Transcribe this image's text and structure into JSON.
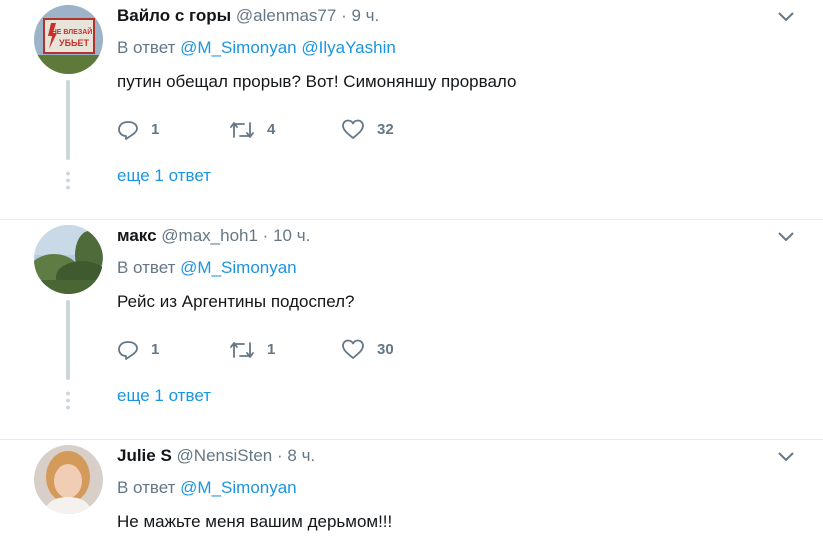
{
  "tweets": [
    {
      "name": "Вайло с горы",
      "handle": "@alenmas77",
      "dot": "·",
      "time": "9 ч.",
      "reply_prefix": "В ответ ",
      "mentions": [
        "@M_Simonyan",
        "@IlyaYashin"
      ],
      "text": "путин обещал прорыв? Вот! Симоняншу прорвало",
      "replies": "1",
      "retweets": "4",
      "likes": "32",
      "more_replies": "еще 1 ответ",
      "avatar_text": [
        "НЕ ВЛЕЗАЙ",
        "УБЬЕТ"
      ]
    },
    {
      "name": "макс",
      "handle": "@max_hoh1",
      "dot": "·",
      "time": "10 ч.",
      "reply_prefix": "В ответ ",
      "mentions": [
        "@M_Simonyan"
      ],
      "text": "Рейс из Аргентины подоспел?",
      "replies": "1",
      "retweets": "1",
      "likes": "30",
      "more_replies": "еще 1 ответ"
    },
    {
      "name": "Julie S",
      "handle": "@NensiSten",
      "dot": "·",
      "time": "8 ч.",
      "reply_prefix": "В ответ ",
      "mentions": [
        "@M_Simonyan"
      ],
      "text": "Не мажьте меня вашим дерьмом!!!"
    }
  ],
  "icons": {
    "caret": "chevron-down-icon",
    "reply": "reply-icon",
    "retweet": "retweet-icon",
    "like": "heart-icon"
  },
  "colors": {
    "link": "#1b95e0",
    "secondary": "#657786",
    "divider": "#e6ecf0",
    "thread": "#ccd6dd"
  }
}
